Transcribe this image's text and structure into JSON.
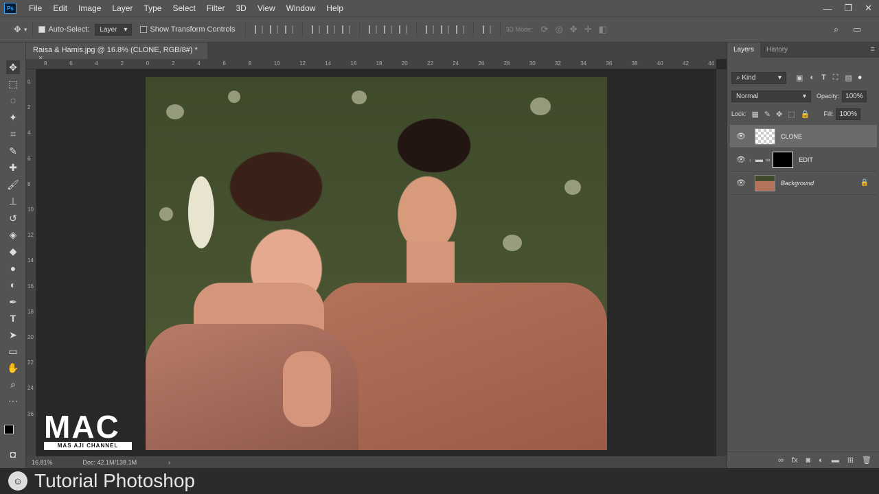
{
  "app": {
    "logo": "Ps"
  },
  "menu": [
    "File",
    "Edit",
    "Image",
    "Layer",
    "Type",
    "Select",
    "Filter",
    "3D",
    "View",
    "Window",
    "Help"
  ],
  "window_controls": {
    "minimize": "—",
    "restore": "❐",
    "close": "✕"
  },
  "options": {
    "auto_select_label": "Auto-Select:",
    "auto_select_checked": true,
    "auto_select_value": "Layer",
    "transform_label": "Show Transform Controls",
    "mode_label": "3D Mode:"
  },
  "document": {
    "tab_title": "Raisa & Hamis.jpg @ 16.8% (CLONE, RGB/8#) *",
    "tab_close": "×"
  },
  "rulers": {
    "h_ticks": [
      "8",
      "6",
      "4",
      "2",
      "0",
      "2",
      "4",
      "6",
      "8",
      "10",
      "12",
      "14",
      "16",
      "18",
      "20",
      "22",
      "24",
      "26",
      "28",
      "30",
      "32",
      "34",
      "36",
      "38",
      "40",
      "42",
      "44"
    ],
    "v_ticks": [
      "0",
      "2",
      "4",
      "6",
      "8",
      "10",
      "12",
      "14",
      "16",
      "18",
      "20",
      "22",
      "24",
      "26"
    ]
  },
  "status": {
    "zoom": "16.81%",
    "doc": "Doc: 42.1M/138.1M",
    "arrow": "›"
  },
  "panel": {
    "tabs": [
      "Layers",
      "History"
    ],
    "kind_label": "Kind",
    "blend_mode": "Normal",
    "opacity_label": "Opacity:",
    "opacity_value": "100%",
    "lock_label": "Lock:",
    "fill_label": "Fill:",
    "fill_value": "100%",
    "layers": [
      {
        "name": "CLONE",
        "selected": true
      },
      {
        "name": "EDIT",
        "selected": false
      },
      {
        "name": "Background",
        "selected": false
      }
    ]
  },
  "watermark": {
    "logo_big": "MAC",
    "logo_small": "MAS AJI CHANNEL",
    "title": "Tutorial Photoshop"
  },
  "colors": {
    "accent": "#31a8ff",
    "panel_bg": "#535353",
    "canvas_bg": "#282828"
  }
}
